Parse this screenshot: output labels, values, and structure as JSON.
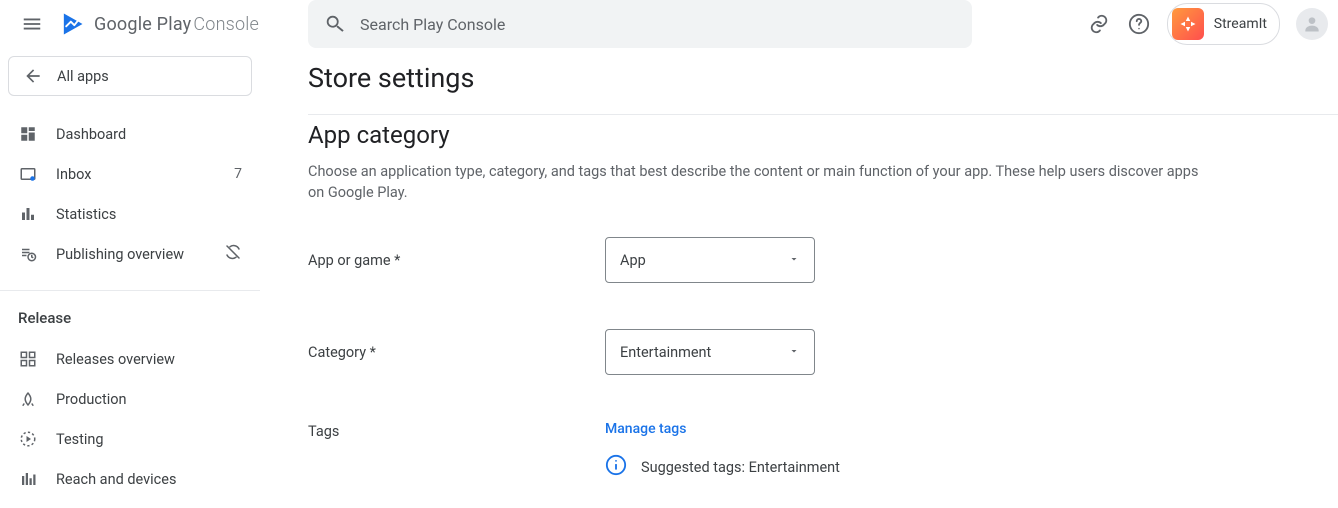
{
  "header": {
    "search_placeholder": "Search Play Console",
    "app_name": "StreamIt",
    "logo_primary": "Google Play",
    "logo_secondary": "Console"
  },
  "sidebar": {
    "all_apps": "All apps",
    "items_top": [
      {
        "label": "Dashboard"
      },
      {
        "label": "Inbox",
        "badge": "7"
      },
      {
        "label": "Statistics"
      },
      {
        "label": "Publishing overview",
        "right_icon": true
      }
    ],
    "section_release": "Release",
    "items_release": [
      {
        "label": "Releases overview"
      },
      {
        "label": "Production"
      },
      {
        "label": "Testing"
      },
      {
        "label": "Reach and devices"
      }
    ]
  },
  "main": {
    "page_title": "Store settings",
    "section_title": "App category",
    "section_desc": "Choose an application type, category, and tags that best describe the content or main function of your app. These help users discover apps on Google Play.",
    "app_or_game_label": "App or game  *",
    "app_or_game_value": "App",
    "category_label": "Category  *",
    "category_value": "Entertainment",
    "tags_label": "Tags",
    "manage_tags": "Manage tags",
    "suggested_tags": "Suggested tags: Entertainment"
  }
}
